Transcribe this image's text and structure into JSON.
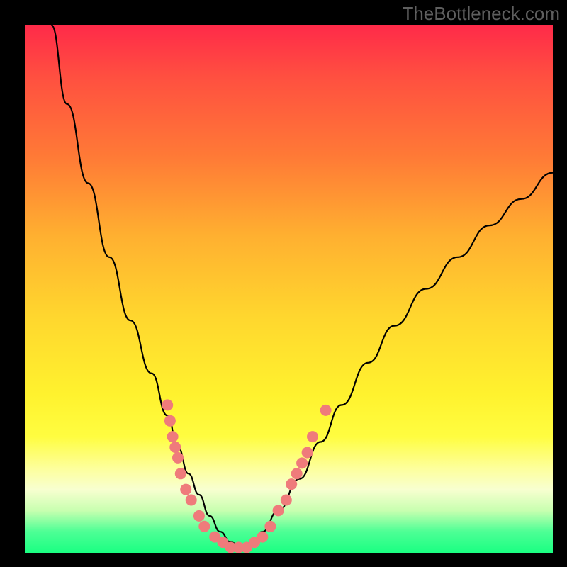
{
  "watermark": "TheBottleneck.com",
  "chart_data": {
    "type": "line",
    "title": "",
    "xlabel": "",
    "ylabel": "",
    "xlim": [
      0,
      100
    ],
    "ylim": [
      0,
      100
    ],
    "gradient_stops": [
      {
        "pos": 0,
        "color": "#ff2a49"
      },
      {
        "pos": 10,
        "color": "#ff5040"
      },
      {
        "pos": 25,
        "color": "#ff7a36"
      },
      {
        "pos": 40,
        "color": "#ffb030"
      },
      {
        "pos": 55,
        "color": "#ffd62e"
      },
      {
        "pos": 70,
        "color": "#fff22e"
      },
      {
        "pos": 78,
        "color": "#fffd40"
      },
      {
        "pos": 84,
        "color": "#fdff9c"
      },
      {
        "pos": 88,
        "color": "#f8ffd0"
      },
      {
        "pos": 92,
        "color": "#c8ffb0"
      },
      {
        "pos": 96,
        "color": "#4dff95"
      },
      {
        "pos": 100,
        "color": "#1aff82"
      }
    ],
    "series": [
      {
        "name": "bottleneck-curve",
        "color": "#000000",
        "x": [
          5,
          8,
          12,
          16,
          20,
          24,
          27,
          29,
          31,
          33,
          35,
          37,
          39,
          41,
          43,
          45,
          48,
          52,
          56,
          60,
          65,
          70,
          76,
          82,
          88,
          94,
          100
        ],
        "y": [
          100,
          85,
          70,
          56,
          44,
          34,
          26,
          20,
          15,
          11,
          7,
          4,
          2,
          1,
          2,
          4,
          8,
          14,
          21,
          28,
          36,
          43,
          50,
          56,
          62,
          67,
          72
        ]
      }
    ],
    "scatter": {
      "name": "highlight-points",
      "color": "#ef7b7b",
      "radius": 8,
      "points": [
        {
          "x": 27,
          "y": 28
        },
        {
          "x": 27.5,
          "y": 25
        },
        {
          "x": 28,
          "y": 22
        },
        {
          "x": 28.5,
          "y": 20
        },
        {
          "x": 29,
          "y": 18
        },
        {
          "x": 29.5,
          "y": 15
        },
        {
          "x": 30.5,
          "y": 12
        },
        {
          "x": 31.5,
          "y": 10
        },
        {
          "x": 33,
          "y": 7
        },
        {
          "x": 34,
          "y": 5
        },
        {
          "x": 36,
          "y": 3
        },
        {
          "x": 37.5,
          "y": 2
        },
        {
          "x": 39,
          "y": 1
        },
        {
          "x": 40.5,
          "y": 1
        },
        {
          "x": 42,
          "y": 1
        },
        {
          "x": 43.5,
          "y": 2
        },
        {
          "x": 45,
          "y": 3
        },
        {
          "x": 46.5,
          "y": 5
        },
        {
          "x": 48,
          "y": 8
        },
        {
          "x": 49.5,
          "y": 10
        },
        {
          "x": 50.5,
          "y": 13
        },
        {
          "x": 51.5,
          "y": 15
        },
        {
          "x": 52.5,
          "y": 17
        },
        {
          "x": 53.5,
          "y": 19
        },
        {
          "x": 54.5,
          "y": 22
        },
        {
          "x": 57,
          "y": 27
        }
      ]
    }
  }
}
